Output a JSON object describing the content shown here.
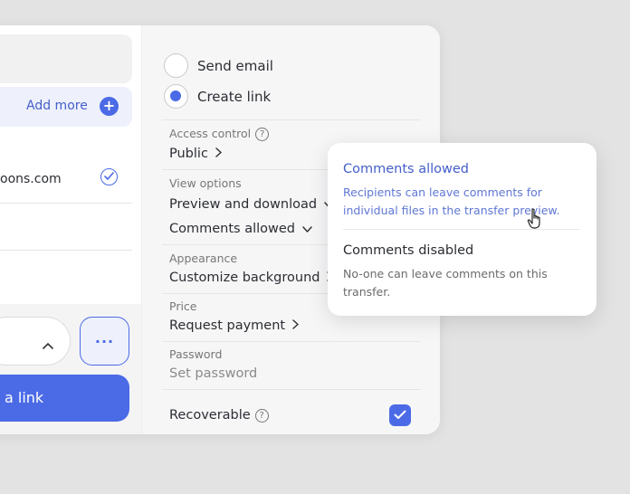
{
  "left": {
    "add_more": "Add more",
    "recipient_email": "oons.com",
    "primary_button": "a link",
    "more_button": "..."
  },
  "transfer": {
    "send_email": "Send email",
    "create_link": "Create link",
    "selected_mode": "Create link"
  },
  "settings": {
    "access_control_label": "Access control",
    "access_control_value": "Public",
    "view_options_label": "View options",
    "view_preview_value": "Preview and download",
    "view_comments_value": "Comments allowed",
    "appearance_label": "Appearance",
    "appearance_value": "Customize background",
    "price_label": "Price",
    "price_value": "Request payment",
    "password_label": "Password",
    "password_placeholder": "Set password",
    "recoverable_label": "Recoverable",
    "recoverable_checked": true
  },
  "popover": {
    "option1_title": "Comments allowed",
    "option1_desc": "Recipients can leave comments for individual files in the transfer preview.",
    "option2_title": "Comments disabled",
    "option2_desc": "No-one can leave comments on this transfer."
  },
  "colors": {
    "accent": "#4b6ae6",
    "accent_text": "#4460c9",
    "background": "#e3e3e3"
  },
  "icons": [
    "plus-icon",
    "check-circle-icon",
    "chevron-up-icon",
    "more-icon",
    "chevron-right-icon",
    "chevron-down-icon",
    "help-icon",
    "checkbox-check-icon",
    "hand-cursor-icon"
  ]
}
